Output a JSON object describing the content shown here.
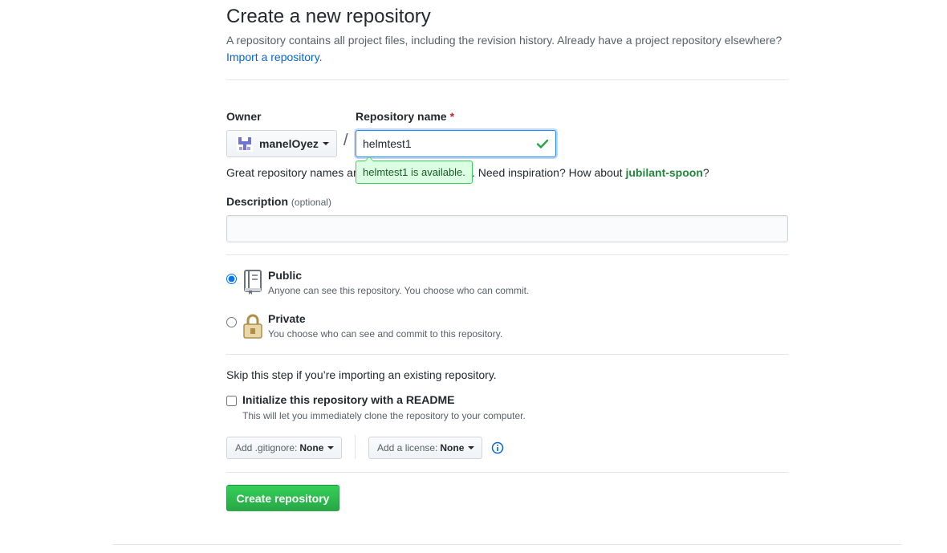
{
  "header": {
    "title": "Create a new repository",
    "subtitle": "A repository contains all project files, including the revision history. Already have a project repository elsewhere?",
    "import_link": "Import a repository."
  },
  "owner": {
    "label": "Owner",
    "value": "manelOyez",
    "avatar_icon": "owner-avatar-icon"
  },
  "repo_name": {
    "label": "Repository name",
    "required_mark": "*",
    "value": "helmtest1",
    "separator": "/",
    "status_icon": "check-icon",
    "availability": "helmtest1 is available."
  },
  "hint": {
    "prefix": "Great repository names ar",
    "middle": ". Need inspiration? How about",
    "suggestion": "jubilant-spoon",
    "suffix": "?"
  },
  "description": {
    "label": "Description",
    "optional": "(optional)",
    "value": ""
  },
  "visibility": {
    "selected": "public",
    "options": [
      {
        "id": "public",
        "title": "Public",
        "note": "Anyone can see this repository. You choose who can commit.",
        "icon": "repo-book-icon"
      },
      {
        "id": "private",
        "title": "Private",
        "note": "You choose who can see and commit to this repository.",
        "icon": "lock-icon"
      }
    ]
  },
  "initialize": {
    "skip_text": "Skip this step if you’re importing an existing repository.",
    "title": "Initialize this repository with a README",
    "note": "This will let you immediately clone the repository to your computer.",
    "checked": false
  },
  "gitignore": {
    "label": "Add .gitignore:",
    "value": "None"
  },
  "license": {
    "label": "Add a license:",
    "value": "None",
    "info_icon": "info-icon"
  },
  "submit": {
    "label": "Create repository"
  },
  "colors": {
    "primary_green": "#28a745",
    "link_blue": "#0366d6",
    "success_bg": "#dcffe4",
    "required_red": "#cb2431"
  }
}
